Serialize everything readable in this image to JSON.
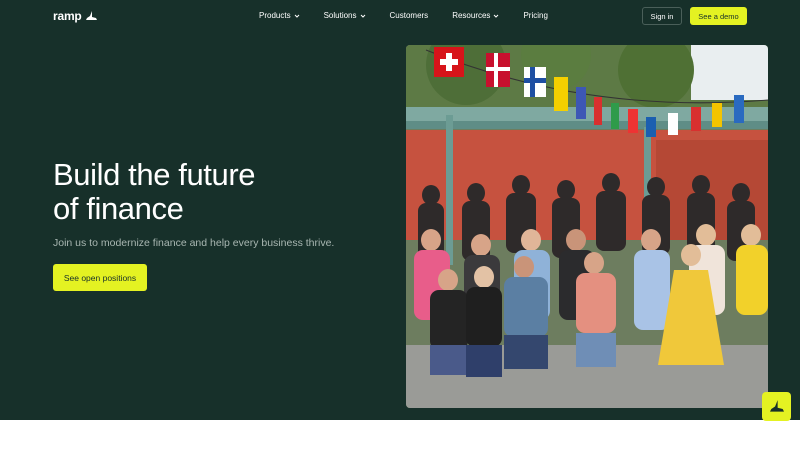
{
  "nav": {
    "logo_text": "ramp",
    "items": [
      {
        "label": "Products",
        "has_dropdown": true
      },
      {
        "label": "Solutions",
        "has_dropdown": true
      },
      {
        "label": "Customers",
        "has_dropdown": false
      },
      {
        "label": "Resources",
        "has_dropdown": true
      },
      {
        "label": "Pricing",
        "has_dropdown": false
      }
    ],
    "signin_label": "Sign in",
    "demo_label": "See a demo"
  },
  "hero": {
    "headline_line1": "Build the future",
    "headline_line2": "of finance",
    "subline": "Join us to modernize finance and help every business thrive.",
    "cta_label": "See open positions"
  },
  "theme": {
    "background": "#17302a",
    "accent": "#e4f222",
    "text": "#ffffff",
    "muted": "#a9b7b2"
  },
  "icons": {
    "logo": "ramp-logo-icon",
    "dropdown": "chevron-down-icon",
    "badge": "ramp-logo-icon"
  },
  "photo": {
    "subject": "team-group-photo"
  }
}
